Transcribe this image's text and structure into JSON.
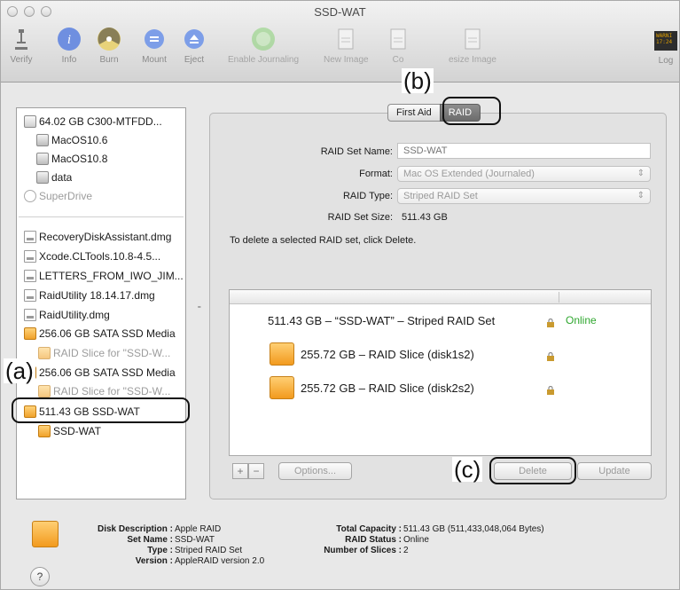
{
  "window": {
    "title": "SSD-WAT"
  },
  "toolbar": {
    "items": [
      {
        "label": "Verify",
        "icon": "microscope-icon"
      },
      {
        "label": "Info",
        "icon": "info-icon"
      },
      {
        "label": "Burn",
        "icon": "burn-icon"
      },
      {
        "label": "Mount",
        "icon": "mount-icon"
      },
      {
        "label": "Eject",
        "icon": "eject-icon"
      },
      {
        "label": "Enable Journaling",
        "icon": "journaling-icon"
      },
      {
        "label": "New Image",
        "icon": "new-image-icon"
      },
      {
        "label": "Co",
        "icon": "convert-icon"
      },
      {
        "label": "esize Image",
        "icon": "resize-image-icon"
      },
      {
        "label": "Log",
        "icon": "log-icon"
      }
    ],
    "log_badge": "WARNI\n17:24"
  },
  "sidebar": {
    "items": [
      {
        "label": "64.02 GB C300-MTFDD...",
        "kind": "disk"
      },
      {
        "label": "MacOS10.6",
        "kind": "volume"
      },
      {
        "label": "MacOS10.8",
        "kind": "volume"
      },
      {
        "label": "data",
        "kind": "volume"
      },
      {
        "label": "SuperDrive",
        "kind": "drive"
      },
      {
        "label": "RecoveryDiskAssistant.dmg",
        "kind": "dmg"
      },
      {
        "label": "Xcode.CLTools.10.8-4.5...",
        "kind": "dmg"
      },
      {
        "label": "LETTERS_FROM_IWO_JIM...",
        "kind": "dmg"
      },
      {
        "label": "RaidUtility 18.14.17.dmg",
        "kind": "dmg"
      },
      {
        "label": "RaidUtility.dmg",
        "kind": "dmg"
      },
      {
        "label": "256.06 GB SATA SSD Media",
        "kind": "disk-orange"
      },
      {
        "label": "RAID Slice for \"SSD-W...",
        "kind": "slice"
      },
      {
        "label": "256.06 GB SATA SSD Media",
        "kind": "disk-orange"
      },
      {
        "label": "RAID Slice for \"SSD-W...",
        "kind": "slice"
      },
      {
        "label": "511.43 GB SSD-WAT",
        "kind": "disk-orange"
      },
      {
        "label": "SSD-WAT",
        "kind": "volume-orange"
      }
    ]
  },
  "tabs": {
    "first_aid": "First Aid",
    "raid": "RAID"
  },
  "raid_form": {
    "name_label": "RAID Set Name:",
    "name_placeholder": "SSD-WAT",
    "format_label": "Format:",
    "format_value": "Mac OS Extended (Journaled)",
    "type_label": "RAID Type:",
    "type_value": "Striped RAID Set",
    "size_label": "RAID Set Size:",
    "size_value": "511.43 GB",
    "delete_hint": "To delete a selected RAID set, click Delete."
  },
  "raid_list": {
    "set_label": "511.43 GB – “SSD-WAT” – Striped RAID Set",
    "status": "Online",
    "slices": [
      "255.72 GB – RAID Slice (disk1s2)",
      "255.72 GB – RAID Slice (disk2s2)"
    ]
  },
  "buttons": {
    "plus": "+",
    "minus": "−",
    "options": "Options...",
    "delete": "Delete",
    "update": "Update"
  },
  "details": {
    "left": [
      {
        "label": "Disk Description :",
        "value": "Apple RAID"
      },
      {
        "label": "Set Name :",
        "value": "SSD-WAT"
      },
      {
        "label": "Type :",
        "value": "Striped RAID Set"
      },
      {
        "label": "Version :",
        "value": "AppleRAID version 2.0"
      }
    ],
    "right": [
      {
        "label": "Total Capacity :",
        "value": "511.43 GB (511,433,048,064 Bytes)"
      },
      {
        "label": "RAID Status :",
        "value": "Online"
      },
      {
        "label": "Number of Slices :",
        "value": "2"
      }
    ],
    "help": "?"
  },
  "annotations": {
    "a": "(a)",
    "b": "(b)",
    "c": "(c)"
  },
  "colors": {
    "online": "#2fa72f",
    "raid_disk": "#f29a1e"
  }
}
